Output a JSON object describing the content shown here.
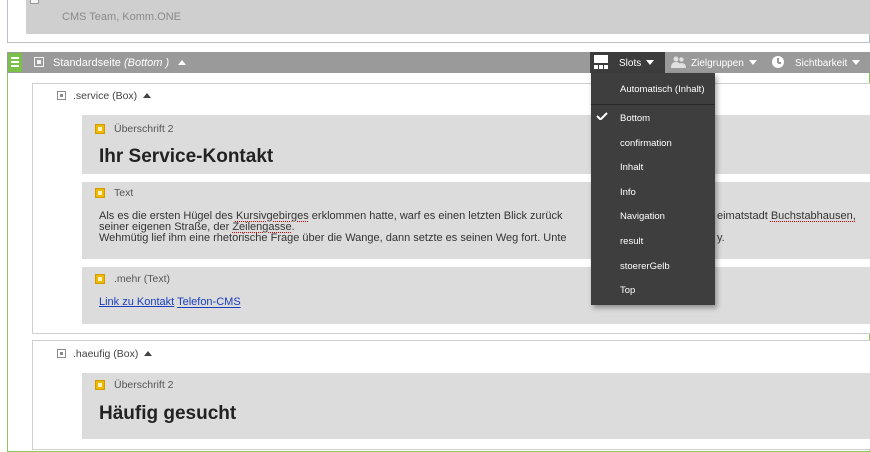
{
  "top_block": {
    "author": "CMS Team, Komm.ONE"
  },
  "page_bar": {
    "title": "Standardseite",
    "subtitle": "(Bottom )",
    "toolbar": {
      "slots": "Slots",
      "zielgruppen": "Zielgruppen",
      "sichtbarkeit": "Sichtbarkeit"
    }
  },
  "slots_menu": {
    "items": [
      "Automatisch (Inhalt)",
      "Bottom",
      "confirmation",
      "Inhalt",
      "Info",
      "Navigation",
      "result",
      "stoererGelb",
      "Top"
    ],
    "selected": "Bottom"
  },
  "service_box": {
    "label": ".service (Box)",
    "heading_element": {
      "label": "Überschrift 2",
      "text": "Ihr Service-Kontakt"
    },
    "text_element": {
      "label": "Text",
      "line1_a": "Als es die ersten Hügel des ",
      "line1_b": "Kursivgebirges",
      "line1_c": " erklommen hatte, warf es einen letzten Blick zurück",
      "line1_d": "eimatstadt ",
      "line1_e": "Buchstabhausen,",
      "line2_a": "seiner eigenen Straße, der ",
      "line2_b": "Zeilengasse",
      "line2_c": ".",
      "line3_a": "Wehmütig lief ihm eine rhetorische Frage über die Wange, dann setzte es seinen Weg fort. Unte",
      "line3_b": "y."
    },
    "mehr_element": {
      "label": ".mehr (Text)",
      "link1": "Link zu Kontakt",
      "link2": "Telefon-CMS"
    }
  },
  "haeufig_box": {
    "label": ".haeufig (Box)",
    "heading_element": {
      "label": "Überschrift 2",
      "text": "Häufig gesucht"
    }
  },
  "colors": {
    "accent_green": "#7bc04a",
    "element_yellow": "#f0b800",
    "bar_gray": "#9a9a9a",
    "menu_dark": "#3e3e3e"
  }
}
